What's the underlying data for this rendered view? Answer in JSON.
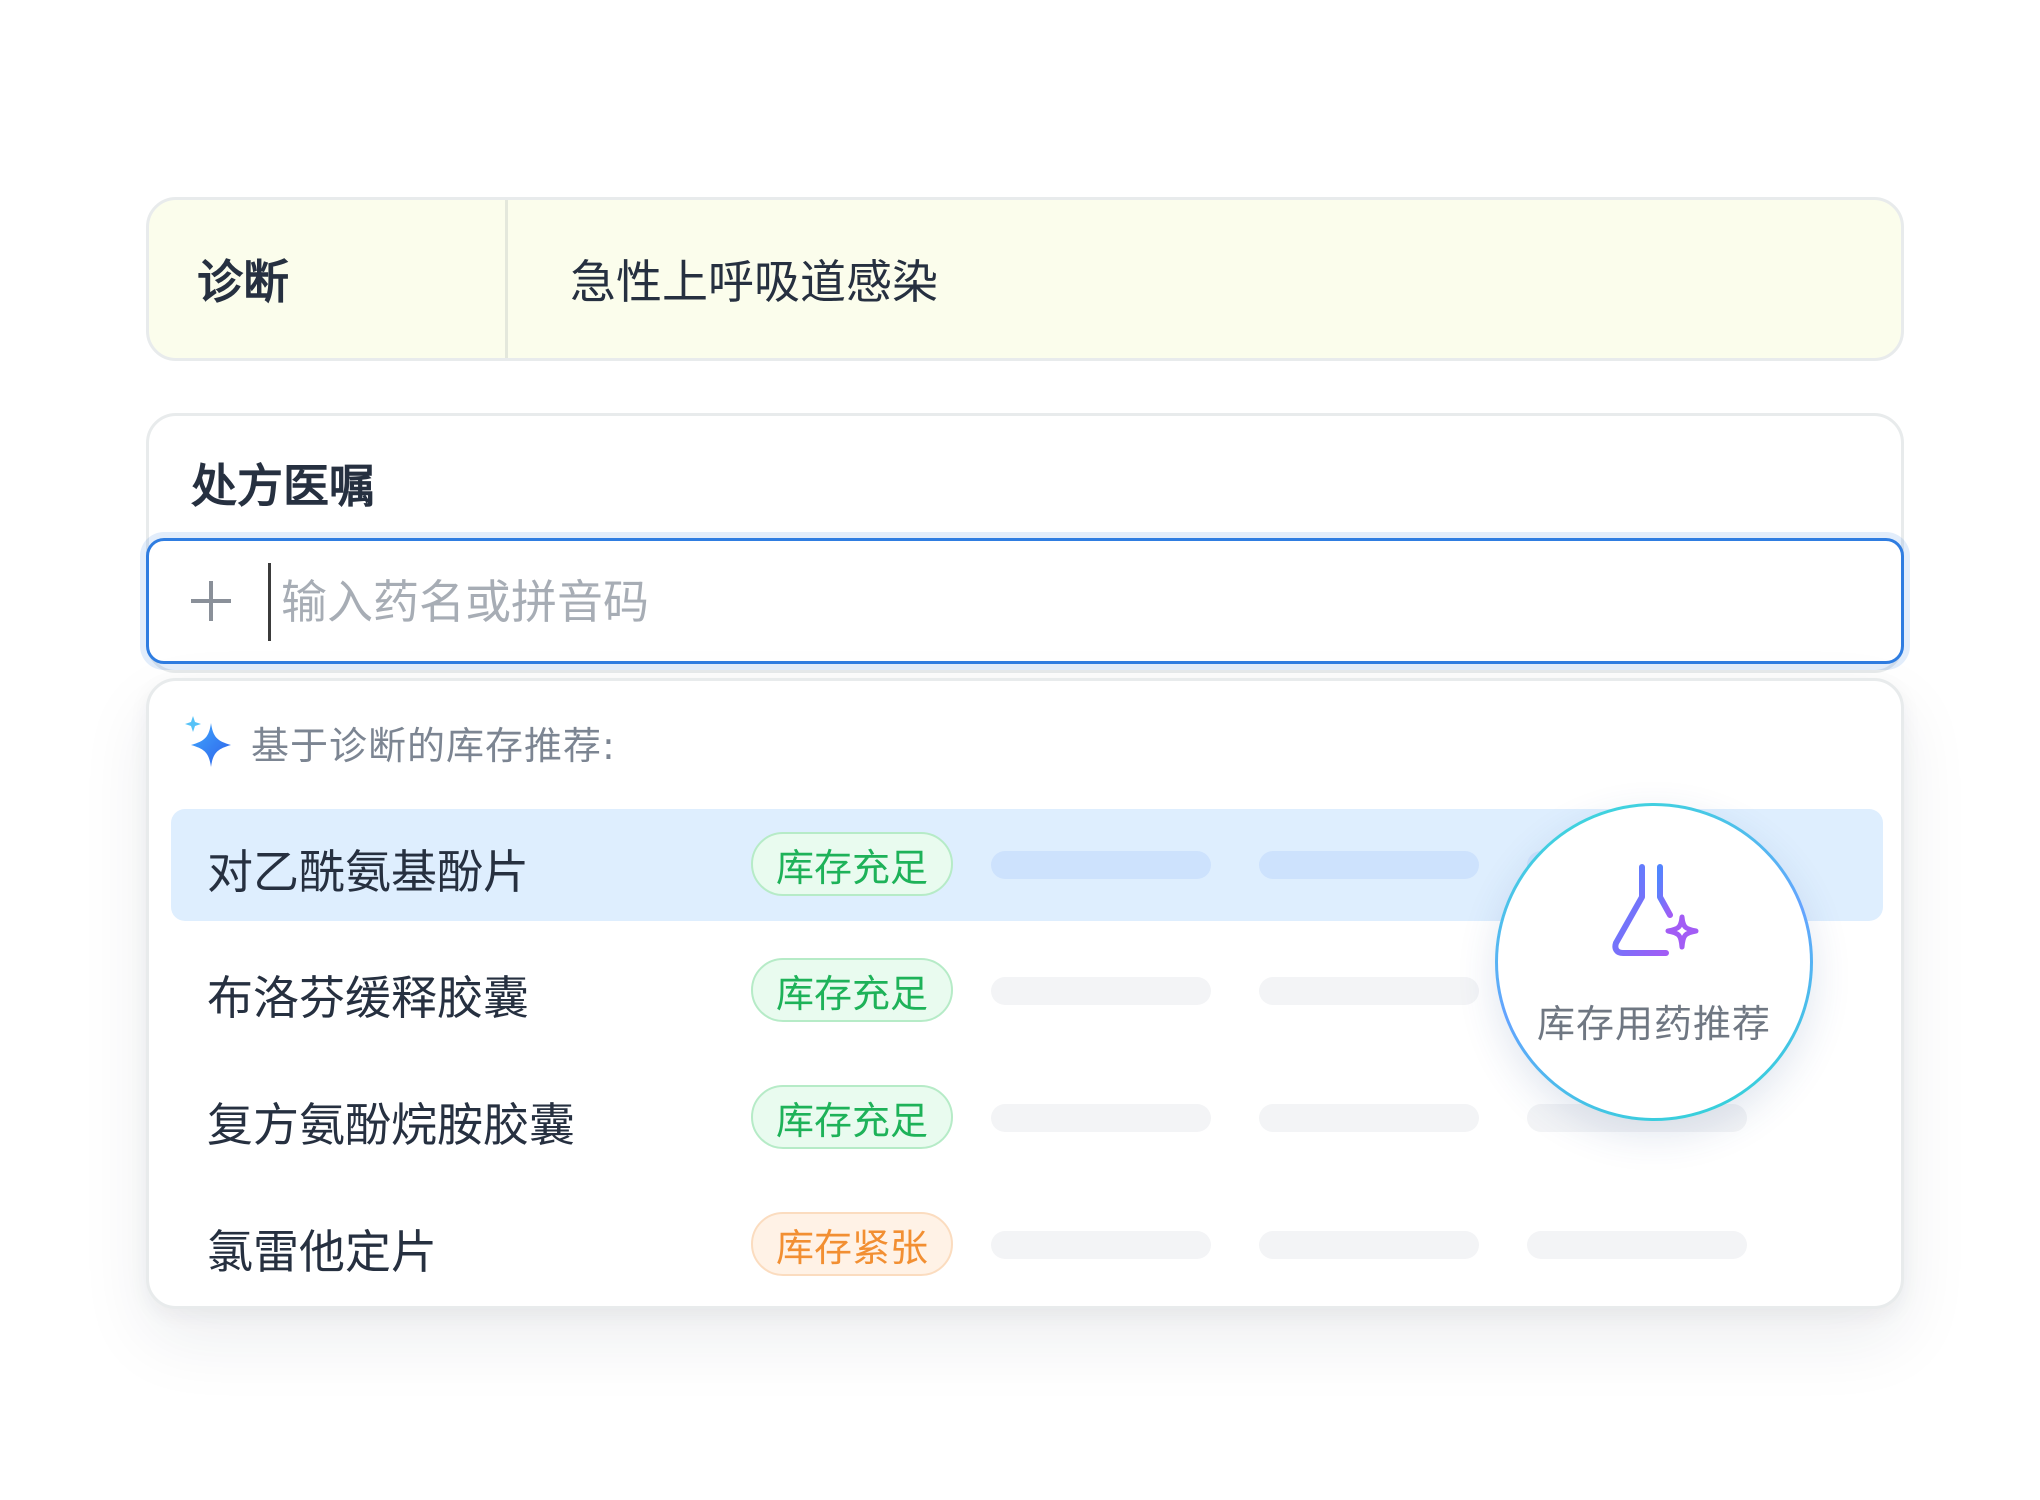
{
  "diagnosis": {
    "label": "诊断",
    "value": "急性上呼吸道感染"
  },
  "prescription": {
    "title": "处方医嘱",
    "search_placeholder": "输入药名或拼音码",
    "search_value": ""
  },
  "recommendation": {
    "header": "基于诊断的库存推荐:",
    "items": [
      {
        "name": "对乙酰氨基酚片",
        "stock": "库存充足",
        "stock_level": "sufficient",
        "selected": true
      },
      {
        "name": "布洛芬缓释胶囊",
        "stock": "库存充足",
        "stock_level": "sufficient",
        "selected": false
      },
      {
        "name": "复方氨酚烷胺胶囊",
        "stock": "库存充足",
        "stock_level": "sufficient",
        "selected": false
      },
      {
        "name": "氯雷他定片",
        "stock": "库存紧张",
        "stock_level": "tight",
        "selected": false
      }
    ]
  },
  "feature": {
    "label": "库存用药推荐",
    "icon": "flask-sparkle-icon"
  },
  "colors": {
    "accent": "#2f7de1",
    "stock_ok": "#1eb259",
    "stock_warn": "#f28f32",
    "selected_row": "#deeefe",
    "diagnosis_bg": "#fbfdec"
  }
}
